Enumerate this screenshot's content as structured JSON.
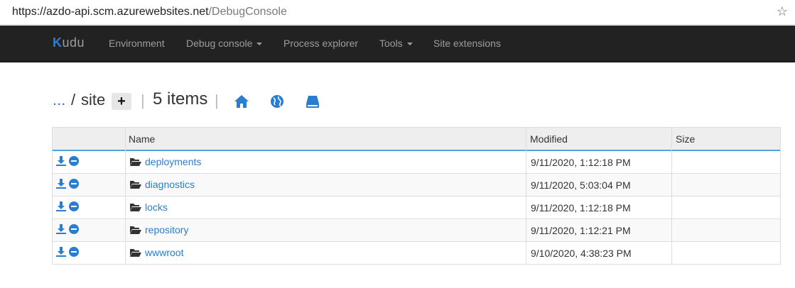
{
  "browser": {
    "url_host": "https://azdo-api.scm.azurewebsites.net",
    "url_path": "/DebugConsole",
    "bookmark_icon": "star-icon"
  },
  "navbar": {
    "brand": {
      "k": "K",
      "rest": "udu"
    },
    "items": [
      {
        "label": "Environment",
        "has_caret": false
      },
      {
        "label": "Debug console",
        "has_caret": true
      },
      {
        "label": "Process explorer",
        "has_caret": false
      },
      {
        "label": "Tools",
        "has_caret": true
      },
      {
        "label": "Site extensions",
        "has_caret": false
      }
    ]
  },
  "breadcrumb": {
    "ellipsis": "...",
    "separator": "/",
    "current_folder": "site",
    "add_label": "+",
    "count_label": "5 items",
    "divider": "|",
    "icons": [
      "home-icon",
      "globe-icon",
      "drive-icon"
    ]
  },
  "table": {
    "headers": {
      "actions": "",
      "name": "Name",
      "modified": "Modified",
      "size": "Size"
    },
    "rows": [
      {
        "name": "deployments",
        "modified": "9/11/2020, 1:12:18 PM",
        "size": ""
      },
      {
        "name": "diagnostics",
        "modified": "9/11/2020, 5:03:04 PM",
        "size": ""
      },
      {
        "name": "locks",
        "modified": "9/11/2020, 1:12:18 PM",
        "size": ""
      },
      {
        "name": "repository",
        "modified": "9/11/2020, 1:12:21 PM",
        "size": ""
      },
      {
        "name": "wwwroot",
        "modified": "9/10/2020, 4:38:23 PM",
        "size": ""
      }
    ]
  },
  "colors": {
    "accent": "#2a7ed0",
    "navbar_bg": "#222222",
    "navbar_text": "#9d9d9d",
    "header_underline": "#4aa3df"
  }
}
